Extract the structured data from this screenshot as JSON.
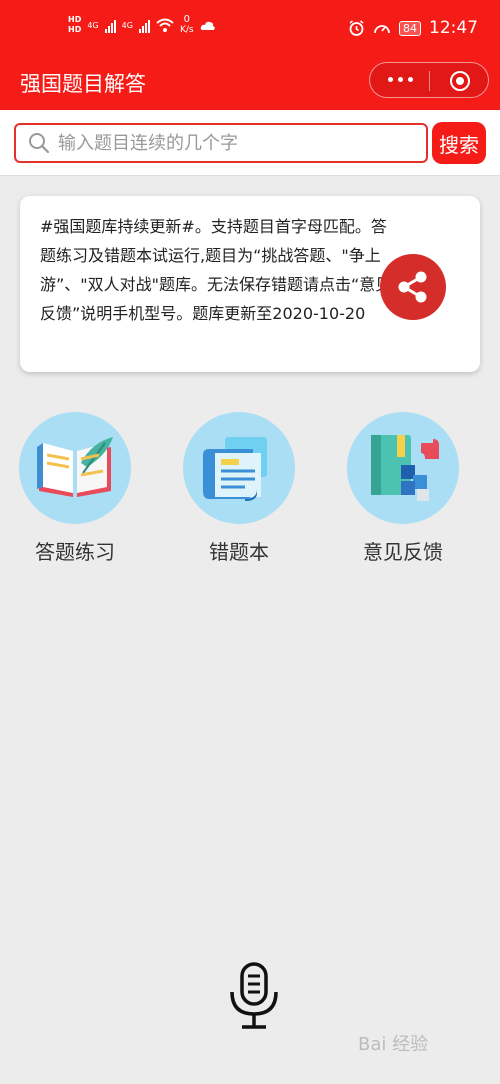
{
  "status_bar": {
    "hd1": "HD",
    "hd2": "HD",
    "net1": "4G",
    "net2": "4G",
    "speed_value": "0",
    "speed_unit": "K/s",
    "battery": "84",
    "time": "12:47"
  },
  "nav": {
    "title": "强国题目解答"
  },
  "search": {
    "placeholder": "输入题目连续的几个字",
    "button_label": "搜索"
  },
  "notice": {
    "text": "#强国题库持续更新#。支持题目首字母匹配。答题练习及错题本试运行,题目为“挑战答题、\"争上游”、\"双人对战\"题库。无法保存错题请点击“意见反馈”说明手机型号。题库更新至2020-10-20"
  },
  "features": [
    {
      "label": "答题练习",
      "icon": "book-quill-icon"
    },
    {
      "label": "错题本",
      "icon": "document-scroll-icon"
    },
    {
      "label": "意见反馈",
      "icon": "puzzle-book-icon"
    }
  ],
  "watermark": "Bai 经验",
  "colors": {
    "brand_red": "#f51b17",
    "search_border": "#e4312b",
    "share_red": "#d42d2a",
    "icon_circle": "#a9def5",
    "page_bg": "#ececec"
  }
}
